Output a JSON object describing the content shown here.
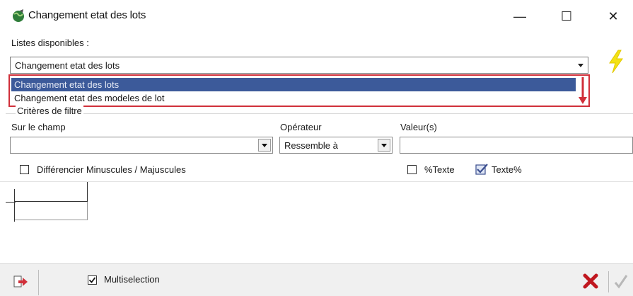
{
  "window": {
    "title": "Changement etat des lots",
    "minimize_glyph": "—",
    "maximize_glyph": "☐",
    "close_glyph": "✕"
  },
  "lists": {
    "label": "Listes disponibles :",
    "selected": "Changement etat des lots",
    "options": [
      "Changement etat des lots",
      "Changement etat des modeles de lot"
    ],
    "highlight_color": "#3c5a9a",
    "annotation_color": "#d0303a"
  },
  "filter": {
    "group_label": "Critères de filtre",
    "field_label": "Sur le champ",
    "field_value": "",
    "operator_label": "Opérateur",
    "operator_value": "Ressemble à",
    "values_label": "Valeur(s)",
    "values_value": "",
    "case_checkbox_label": "Différencier Minuscules / Majuscules",
    "case_checked": false,
    "prefix_label": "%Texte",
    "prefix_checked": false,
    "suffix_label": "Texte%",
    "suffix_checked": true
  },
  "footer": {
    "multiselection_label": "Multiselection",
    "multiselection_checked": true
  },
  "icons": {
    "app": "green-globe-icon",
    "refresh": "lightning-bolt-icon",
    "export": "export-arrow-icon",
    "cancel": "red-x-icon",
    "ok": "checkmark-icon"
  }
}
